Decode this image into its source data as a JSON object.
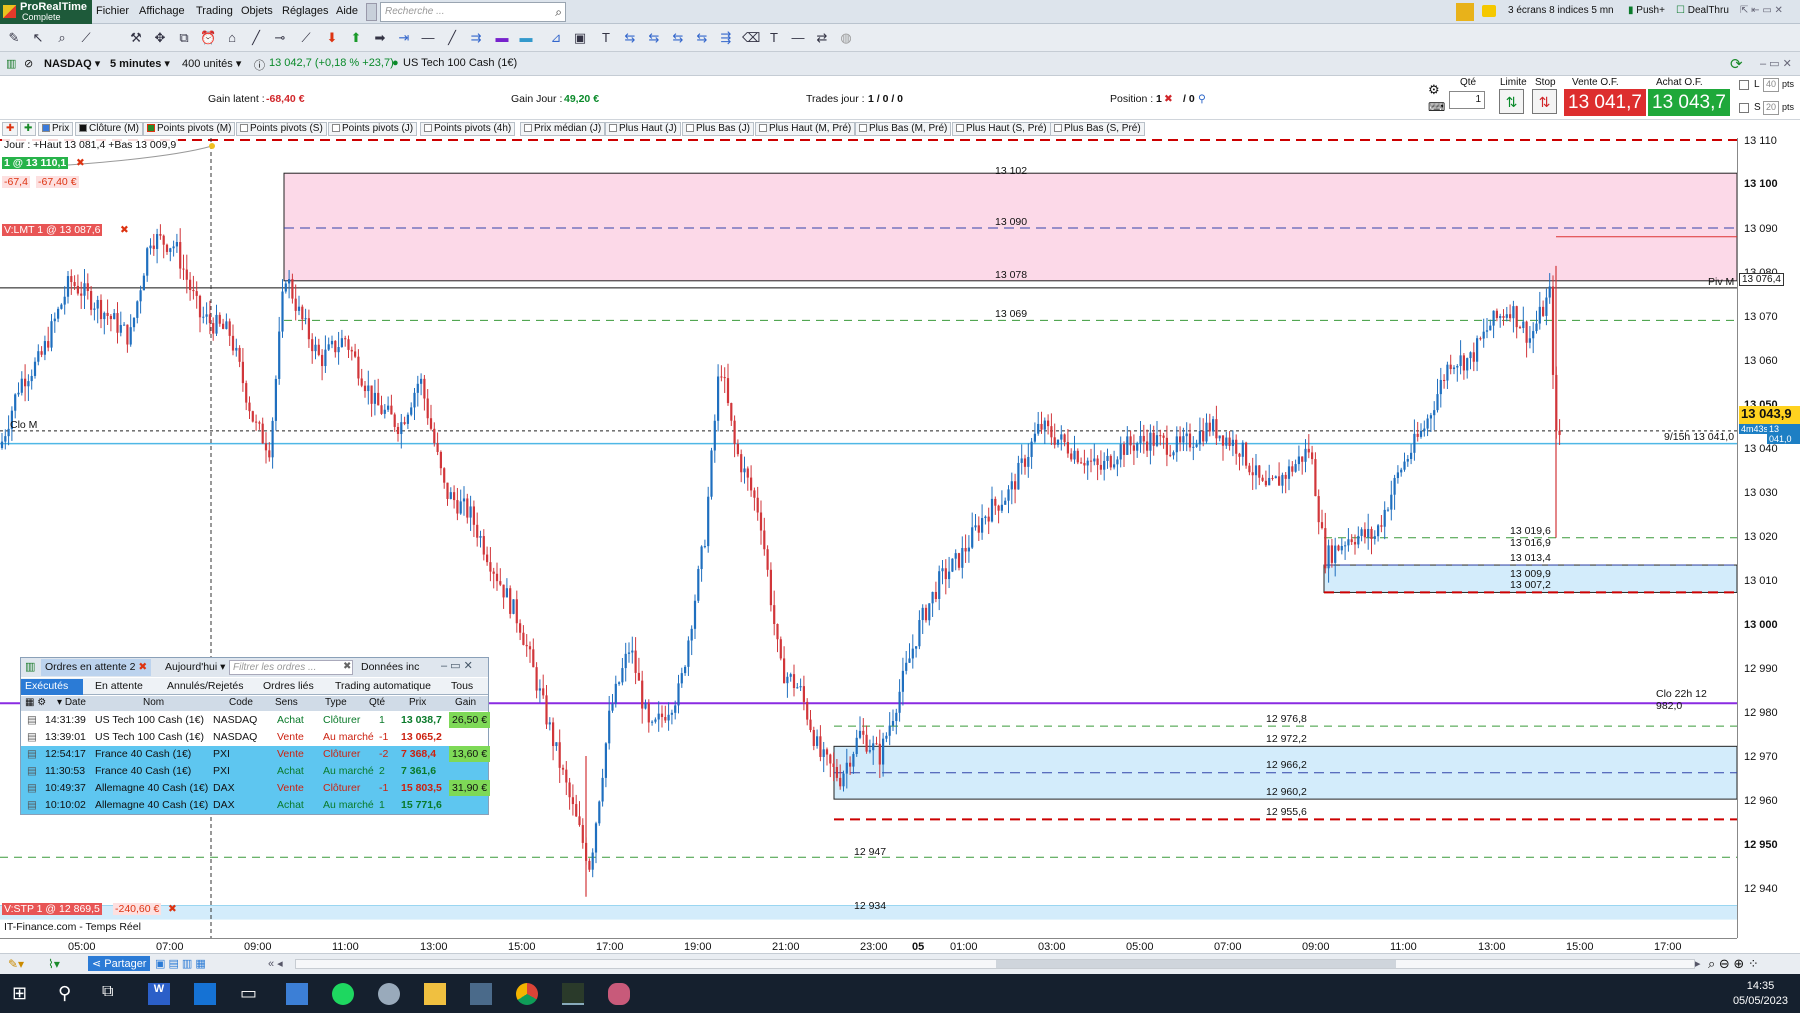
{
  "app": {
    "logo_line1": "ProRealTime",
    "logo_line2": "Complete"
  },
  "menu": [
    "Fichier",
    "Affichage",
    "Trading",
    "Objets",
    "Réglages",
    "Aide"
  ],
  "search": {
    "placeholder": "Recherche ..."
  },
  "topright": {
    "layout": "3 écrans 8 indices 5 mn",
    "push": "Push+",
    "dealthru": "DealThru"
  },
  "instrument": {
    "market": "NASDAQ",
    "timeframe": "5 minutes",
    "units": "400 unités",
    "quote": "13 042,7 (+0,18 % +23,7)",
    "name": "US Tech 100 Cash (1€)"
  },
  "info": {
    "gain_latent_label": "Gain latent :",
    "gain_latent": "-68,40 €",
    "gain_jour_label": "Gain Jour :",
    "gain_jour": "49,20 €",
    "trades_label": "Trades jour :",
    "trades": "1 / 0 / 0",
    "position_label": "Position :",
    "position_qty": "1",
    "position_other": "/ 0",
    "qte_label": "Qté",
    "qte_value": "1",
    "limite_label": "Limite",
    "stop_label": "Stop",
    "vente_label": "Vente O.F.",
    "vente_value": "13 041,7",
    "achat_label": "Achat O.F.",
    "achat_value": "13 043,7",
    "l_label": "L",
    "l_pts": "40",
    "s_label": "S",
    "s_pts": "20",
    "pts": "pts"
  },
  "indicators": [
    "Prix",
    "Clôture (M)",
    "Points pivots (M)",
    "Points pivots (S)",
    "Points pivots (J)",
    "Points pivots (4h)",
    "Prix médian (J)",
    "Plus Haut (J)",
    "Plus Bas (J)",
    "Plus Haut (M, Pré)",
    "Plus Bas (M, Pré)",
    "Plus Haut (S, Pré)",
    "Plus Bas (S, Pré)"
  ],
  "chart_labels": {
    "jour": "Jour : +Haut 13 081,4 +Bas 13 009,9",
    "pos": "1 @ 13 110,1",
    "pos_pnl1": "-67,4",
    "pos_pnl2": "-67,40 €",
    "vlmt": "V:LMT 1 @ 13 087,6",
    "vstp": "V:STP 1 @ 12 869,5",
    "vstp_pnl": "-240,60 €",
    "clo_m": "Clo M",
    "piv_m": "Piv M",
    "clo22": "Clo 22h 12 982,0",
    "h915": "9/15h 13 041,0",
    "feed": "IT-Finance.com - Temps Réel",
    "levels": [
      "13 102",
      "13 090",
      "13 078",
      "13 069",
      "13 019,6",
      "13 016,9",
      "13 013,4",
      "13 009,9",
      "13 007,2",
      "12 976,8",
      "12 972,2",
      "12 966,2",
      "12 960,2",
      "12 955,6",
      "12 947",
      "12 934"
    ]
  },
  "yaxis": {
    "ticks": [
      "13 110",
      "13 100",
      "13 090",
      "13 080",
      "13 070",
      "13 060",
      "13 050",
      "13 040",
      "13 030",
      "13 020",
      "13 010",
      "13 000",
      "12 990",
      "12 980",
      "12 970",
      "12 960",
      "12 950",
      "12 940"
    ],
    "price_marker": "13 043,9",
    "price_marker_sub": "4m43s",
    "marker_1": "13 076,4",
    "marker_2": "13 041,0"
  },
  "xaxis": {
    "ticks": [
      "05:00",
      "07:00",
      "09:00",
      "11:00",
      "13:00",
      "15:00",
      "17:00",
      "19:00",
      "21:00",
      "23:00",
      "05",
      "01:00",
      "03:00",
      "05:00",
      "07:00",
      "09:00",
      "11:00",
      "13:00",
      "15:00",
      "17:00"
    ]
  },
  "orders_panel": {
    "title": "Ordres en attente",
    "count": "2",
    "period": "Aujourd'hui",
    "filter_placeholder": "Filtrer les ordres ...",
    "data_tab": "Données inc",
    "tabs": [
      "Exécutés",
      "En attente",
      "Annulés/Rejetés",
      "Ordres liés",
      "Trading automatique",
      "Tous"
    ],
    "columns": [
      "Date",
      "Nom",
      "Code",
      "Sens",
      "Type",
      "Qté",
      "Prix",
      "Gain"
    ],
    "rows": [
      {
        "time": "14:31:39",
        "name": "US Tech 100 Cash (1€)",
        "code": "NASDAQ",
        "sens": "Achat",
        "type": "Clôturer",
        "qty": "1",
        "price": "13 038,7",
        "gain": "26,50 €"
      },
      {
        "time": "13:39:01",
        "name": "US Tech 100 Cash (1€)",
        "code": "NASDAQ",
        "sens": "Vente",
        "type": "Au marché",
        "qty": "-1",
        "price": "13 065,2",
        "gain": ""
      },
      {
        "time": "12:54:17",
        "name": "France 40 Cash (1€)",
        "code": "PXI",
        "sens": "Vente",
        "type": "Clôturer",
        "qty": "-2",
        "price": "7 368,4",
        "gain": "13,60 €"
      },
      {
        "time": "11:30:53",
        "name": "France 40 Cash (1€)",
        "code": "PXI",
        "sens": "Achat",
        "type": "Au marché",
        "qty": "2",
        "price": "7 361,6",
        "gain": ""
      },
      {
        "time": "10:49:37",
        "name": "Allemagne 40 Cash (1€)",
        "code": "DAX",
        "sens": "Vente",
        "type": "Clôturer",
        "qty": "-1",
        "price": "15 803,5",
        "gain": "31,90 €"
      },
      {
        "time": "10:10:02",
        "name": "Allemagne 40 Cash (1€)",
        "code": "DAX",
        "sens": "Achat",
        "type": "Au marché",
        "qty": "1",
        "price": "15 771,6",
        "gain": ""
      }
    ]
  },
  "bottombar": {
    "share": "Partager"
  },
  "taskbar": {
    "time": "14:35",
    "date": "05/05/2023"
  },
  "colors": {
    "up": "#1f6fbf",
    "down": "#d1363a",
    "pink_zone": "#fcd9e8",
    "blue_zone": "#d3ecfb",
    "accent": "#ffd21f"
  }
}
